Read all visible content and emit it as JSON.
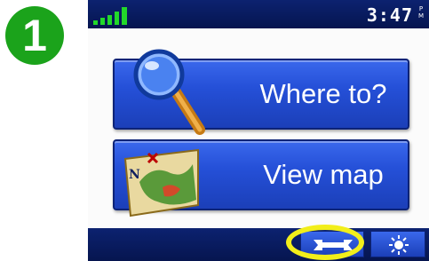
{
  "step_number": "1",
  "status_bar": {
    "time": "3:47",
    "ampm_top": "P",
    "ampm_bottom": "M",
    "signal_bars": 5
  },
  "menu": {
    "where_to_label": "Where to?",
    "view_map_label": "View map",
    "where_to_icon": "magnifier-icon",
    "view_map_icon": "map-icon"
  },
  "toolbar": {
    "settings_icon": "wrench-icon",
    "brightness_icon": "sun-icon"
  },
  "colors": {
    "badge": "#1ba31b",
    "bar": "#0c2270",
    "button": "#2550d8",
    "highlight": "#f2ee1a"
  }
}
